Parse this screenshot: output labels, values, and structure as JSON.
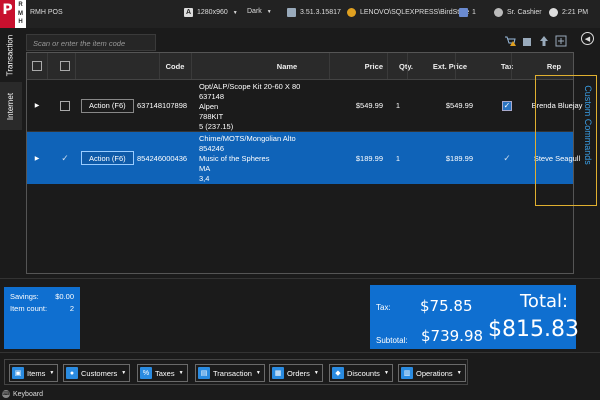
{
  "titlebar": {
    "logo_letter": "P",
    "logo_sub": [
      "R",
      "M",
      "H"
    ],
    "app_title": "RMH POS",
    "resolution": "1280x960",
    "theme": "Dark",
    "version": "3.51.3.15817",
    "database": "LENOVO\\SQLEXPRESS\\BirdStore",
    "register": "1",
    "user": "Sr. Cashier",
    "time": "2:21 PM"
  },
  "tabs": {
    "transaction": "Transaction",
    "internet": "Internet"
  },
  "right_panel": {
    "label": "Custom Commands"
  },
  "search": {
    "placeholder": "Scan or enter the item code"
  },
  "grid": {
    "columns": {
      "code": "Code",
      "name": "Name",
      "price": "Price",
      "qty": "Qty.",
      "ext_price": "Ext. Price",
      "tax": "Tax",
      "rep": "Rep"
    },
    "rows": [
      {
        "action": "Action (F6)",
        "code": "637148107898",
        "name_lines": [
          "Opt/ALP/Scope Kit 20-60 X 80",
          "637148",
          "Alpen",
          "788KIT",
          "5 (237.15)"
        ],
        "price": "$549.99",
        "qty": "1",
        "ext_price": "$549.99",
        "rep": "Brenda Bluejay",
        "selected": false
      },
      {
        "action": "Action (F6)",
        "code": "854246000436",
        "name_lines": [
          "Chime/MOTS/Mongolian Alto",
          "854246",
          "Music of the Spheres",
          "MA",
          "3,4"
        ],
        "price": "$189.99",
        "qty": "1",
        "ext_price": "$189.99",
        "rep": "Steve Seagull",
        "selected": true
      }
    ]
  },
  "summary": {
    "savings_label": "Savings:",
    "savings_value": "$0.00",
    "item_count_label": "Item count:",
    "item_count_value": "2",
    "tax_label": "Tax:",
    "tax_value": "$75.85",
    "subtotal_label": "Subtotal:",
    "subtotal_value": "$739.98",
    "total_label": "Total:",
    "total_value": "$815.83"
  },
  "toolbar": [
    {
      "label": "Items",
      "icon": "box-icon"
    },
    {
      "label": "Customers",
      "icon": "person-icon"
    },
    {
      "label": "Taxes",
      "icon": "percent-icon"
    },
    {
      "label": "Transaction",
      "icon": "bag-icon"
    },
    {
      "label": "Orders",
      "icon": "cart-icon"
    },
    {
      "label": "Discounts",
      "icon": "tag-icon"
    },
    {
      "label": "Operations",
      "icon": "register-icon"
    }
  ],
  "statusbar": {
    "keyboard": "Keyboard"
  },
  "colors": {
    "accent": "#0f6fd0",
    "selected_row": "#0f63b8",
    "brand_red": "#c8102e",
    "highlight": "#e0b030",
    "link": "#3aa0e8"
  }
}
